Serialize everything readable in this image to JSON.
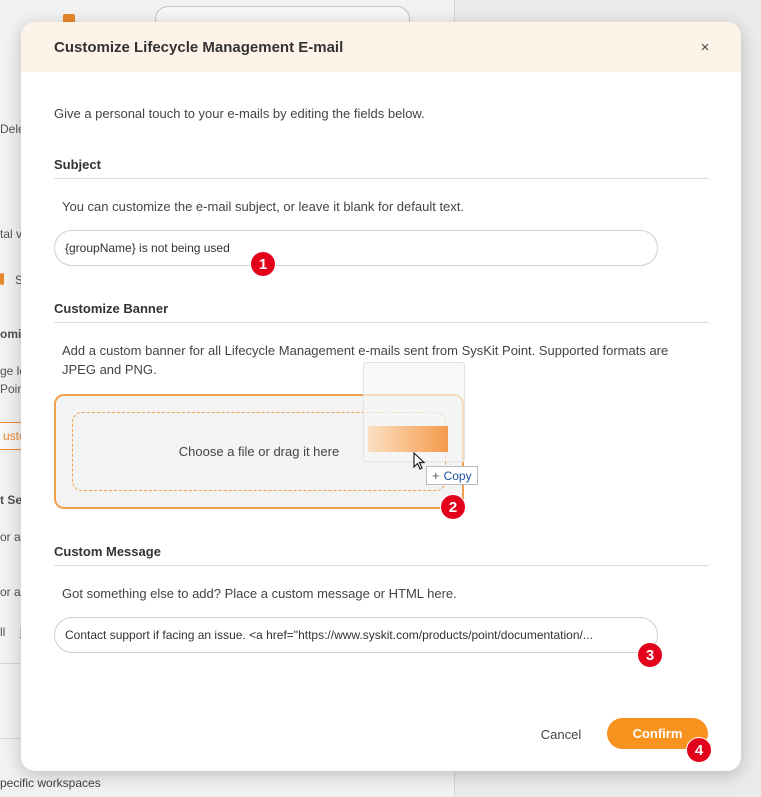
{
  "background": {
    "fragments": [
      "Delet",
      "tal v",
      "S",
      "omiz",
      "ge lo",
      "Poin",
      "usto",
      "t Se",
      "or a",
      "or a",
      "ll",
      "M"
    ],
    "bottom_text": "pecific workspaces"
  },
  "modal": {
    "title": "Customize Lifecycle Management E-mail",
    "close_glyph": "×",
    "intro": "Give a personal touch to your e-mails by editing the fields below.",
    "subject": {
      "title": "Subject",
      "description": "You can customize the e-mail subject, or leave it blank for default text.",
      "value": "{groupName} is not being used"
    },
    "banner": {
      "title": "Customize Banner",
      "description": "Add a custom banner for all Lifecycle Management e-mails sent from SysKit Point. Supported formats are JPEG and PNG.",
      "drop_label": "Choose a file or drag it here",
      "copy_plus": "+",
      "copy_label": "Copy"
    },
    "message": {
      "title": "Custom Message",
      "description": "Got something else to add? Place a custom message or HTML here.",
      "value": "Contact support if facing an issue. <a href=\"https://www.syskit.com/products/point/documentation/..."
    },
    "buttons": {
      "cancel": "Cancel",
      "confirm": "Confirm"
    }
  },
  "step_badges": [
    "1",
    "2",
    "3",
    "4"
  ],
  "colors": {
    "accent": "#f7931e",
    "badge": "#e3001b",
    "header_bg": "#fdf3e9"
  }
}
